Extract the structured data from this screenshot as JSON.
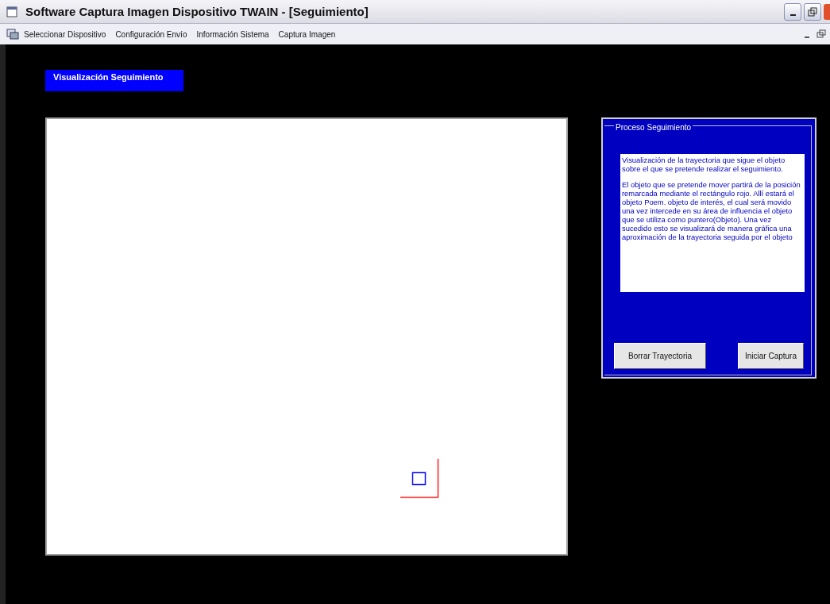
{
  "window": {
    "title": "Software Captura Imagen Dispositivo TWAIN  - [Seguimiento]"
  },
  "menu": {
    "items": [
      "Seleccionar Dispositivo",
      "Configuración Envío",
      "Información Sistema",
      "Captura Imagen"
    ]
  },
  "view_label": "Visualización Seguimiento",
  "panel": {
    "title": "Proceso Seguimiento",
    "description": [
      "Visualización de la trayectoria que sigue el objeto sobre el que se pretende realizar el seguimiento.",
      "El objeto que se pretende mover partirá de la posición remarcada mediante el rectángulo rojo. Allí estará el objeto Poem. objeto de interés, el cual será movido una vez intercede en su área de influencia el objeto que se utiliza como puntero(Objeto). Una vez sucedido esto se visualizará de manera gráfica una aproximación de la trayectoria seguida por el objeto"
    ],
    "buttons": [
      "Borrar Trayectoria",
      "Iniciar Captura"
    ]
  }
}
